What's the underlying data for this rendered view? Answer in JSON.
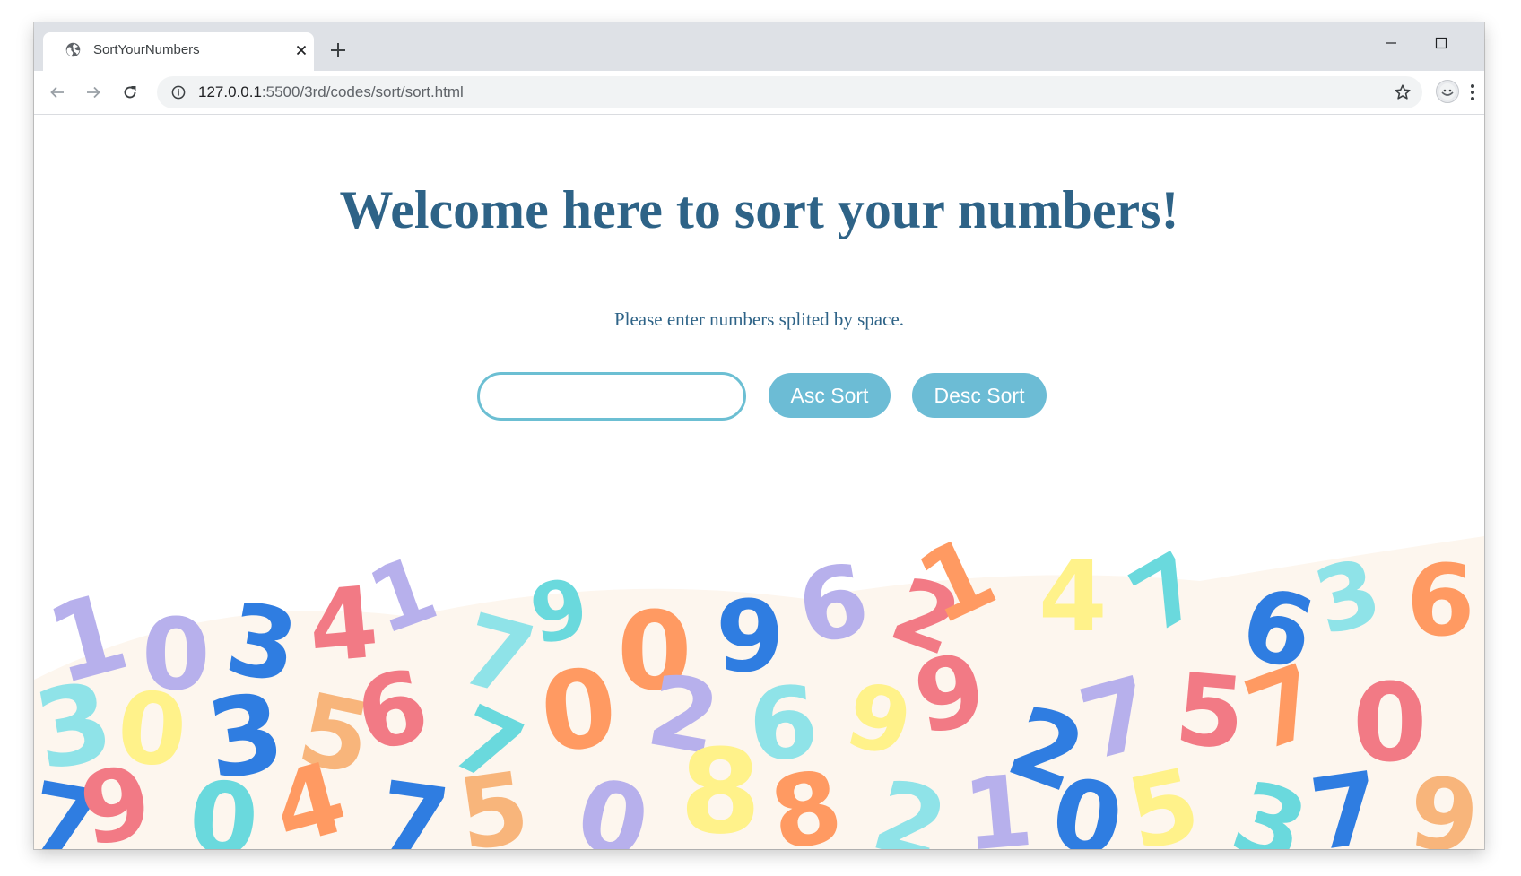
{
  "browser": {
    "tab": {
      "title": "SortYourNumbers",
      "favicon": "globe-icon"
    },
    "window_controls": [
      "minimize-icon",
      "maximize-icon",
      "close-icon"
    ],
    "address_bar": {
      "host": "127.0.0.1",
      "path": ":5500/3rd/codes/sort/sort.html"
    },
    "toolbar_icons": [
      "back-arrow-icon",
      "forward-arrow-icon",
      "reload-icon",
      "info-icon",
      "star-icon",
      "profile-avatar",
      "more-vert-icon"
    ]
  },
  "page": {
    "heading": "Welcome here to sort your numbers!",
    "instruction": "Please enter numbers splited by space.",
    "numbers_input": {
      "value": "",
      "placeholder": ""
    },
    "buttons": {
      "asc": "Asc Sort",
      "desc": "Desc Sort"
    },
    "colors": {
      "heading": "#2e6387",
      "button_bg": "#6cbcd5",
      "input_border": "#6cbfd3",
      "confetti": [
        "#f27a85",
        "#ff9a62",
        "#fff28a",
        "#8fe3e8",
        "#b7b0ec",
        "#2f7de1",
        "#f8b57b"
      ]
    }
  }
}
